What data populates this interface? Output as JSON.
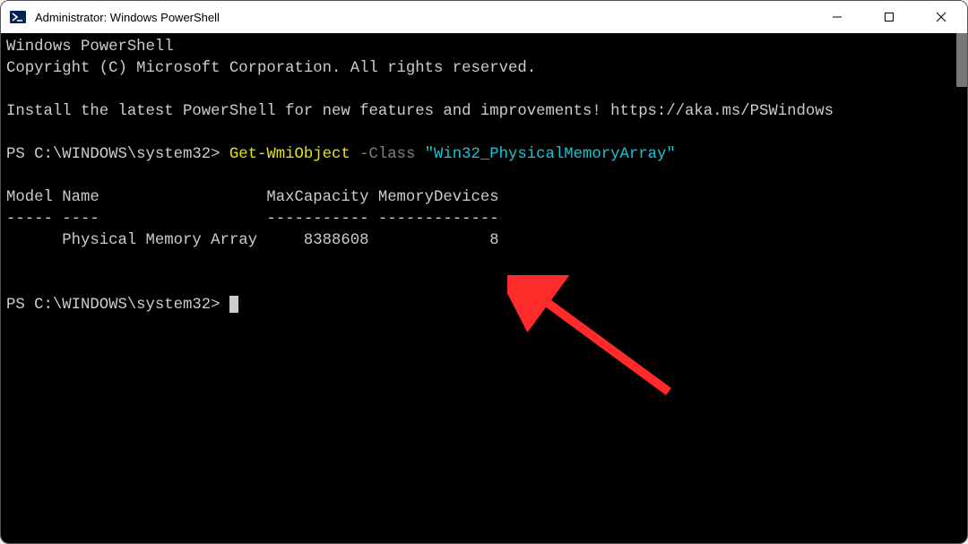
{
  "titlebar": {
    "title": "Administrator: Windows PowerShell"
  },
  "terminal": {
    "banner_line1": "Windows PowerShell",
    "banner_line2": "Copyright (C) Microsoft Corporation. All rights reserved.",
    "install_msg": "Install the latest PowerShell for new features and improvements! https://aka.ms/PSWindows",
    "prompt1_prefix": "PS C:\\WINDOWS\\system32> ",
    "cmd_name": "Get-WmiObject",
    "cmd_param": " -Class ",
    "cmd_arg": "\"Win32_PhysicalMemoryArray\"",
    "header_line": "Model Name                  MaxCapacity MemoryDevices",
    "divider_line": "----- ----                  ----------- -------------",
    "data_line": "      Physical Memory Array     8388608             8",
    "prompt2": "PS C:\\WINDOWS\\system32> "
  },
  "output_data": {
    "columns": [
      "Model",
      "Name",
      "MaxCapacity",
      "MemoryDevices"
    ],
    "rows": [
      {
        "Model": "",
        "Name": "Physical Memory Array",
        "MaxCapacity": 8388608,
        "MemoryDevices": 8
      }
    ]
  }
}
